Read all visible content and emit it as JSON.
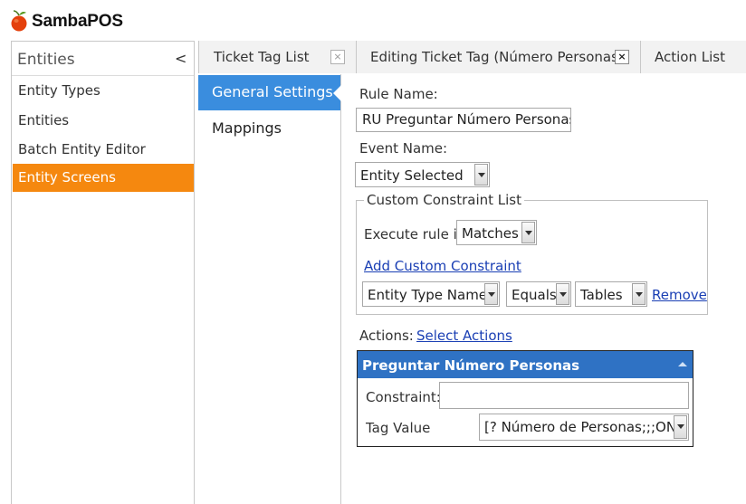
{
  "app": {
    "title": "SambaPOS",
    "logo_icon": "orange-fruit-icon"
  },
  "sidebar": {
    "title": "Entities",
    "collapse_glyph": "<",
    "items": [
      {
        "label": "Entity Types",
        "active": false
      },
      {
        "label": "Entities",
        "active": false
      },
      {
        "label": "Batch Entity Editor",
        "active": false
      },
      {
        "label": "Entity Screens",
        "active": true
      }
    ]
  },
  "tabs": [
    {
      "label": "Ticket Tag List",
      "close": "×"
    },
    {
      "label": "Editing Ticket Tag (Número Personas)",
      "close": "×"
    },
    {
      "label": "Action List"
    }
  ],
  "settings_menu": {
    "items": [
      {
        "label": "General Settings",
        "active": true
      },
      {
        "label": "Mappings",
        "active": false
      }
    ]
  },
  "form": {
    "rule_name_label": "Rule Name:",
    "rule_name_value": "RU Preguntar Número Personas",
    "event_name_label": "Event Name:",
    "event_name_value": "Entity Selected",
    "constraints": {
      "legend": "Custom Constraint List",
      "execute_label": "Execute rule if",
      "execute_value": "Matches",
      "add_link": "Add Custom Constraint",
      "row": {
        "field": "Entity Type Name",
        "operator": "Equals",
        "value": "Tables",
        "remove_link": "Remove"
      }
    },
    "actions_label": "Actions:",
    "select_actions_link": "Select Actions",
    "action": {
      "title": "Preguntar Número Personas",
      "constraint_label": "Constraint:",
      "constraint_value": "",
      "tag_value_label": "Tag Value",
      "tag_value": "[? Número de Personas;;;ON]"
    }
  },
  "colors": {
    "accent_orange": "#f5880f",
    "selected_blue": "#3a8dde",
    "action_header_blue": "#2f72c4",
    "link_blue": "#1a3fb4"
  }
}
